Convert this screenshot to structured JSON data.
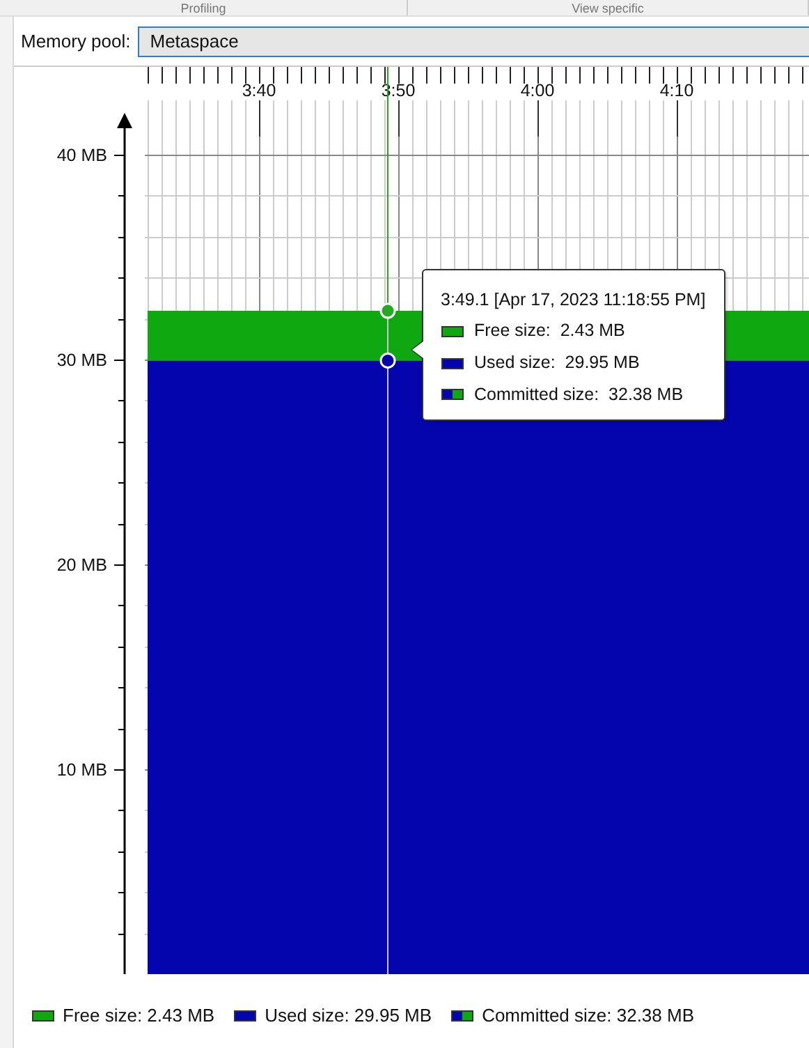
{
  "section_headers": [
    "Profiling",
    "View specific"
  ],
  "memory_pool": {
    "label": "Memory pool:",
    "value": "Metaspace"
  },
  "chart": {
    "chart_data": {
      "type": "area",
      "stacked": true,
      "grid": true,
      "ylim": [
        0,
        41.7
      ],
      "categories": [
        null,
        null,
        null,
        null,
        null,
        null,
        null,
        null,
        "3:40",
        null,
        null,
        null,
        null,
        null,
        null,
        null,
        null,
        null,
        "3:50",
        null,
        null,
        null,
        null,
        null,
        null,
        null,
        null,
        null,
        "4:00",
        null,
        null,
        null,
        null,
        null,
        null,
        null,
        null,
        null,
        "4:10",
        null,
        null,
        null,
        null,
        null,
        null,
        null,
        null,
        null,
        null
      ],
      "series": [
        {
          "color": "#0505ad",
          "values": [
            29.95,
            29.95,
            29.95,
            29.95,
            29.95,
            29.95,
            29.95,
            29.95,
            29.95,
            29.95,
            29.95,
            29.95,
            29.95,
            29.95,
            29.95,
            29.95,
            29.95,
            null,
            29.95,
            29.95,
            null,
            null,
            null,
            null,
            null,
            null,
            null,
            null,
            null,
            null,
            null,
            null,
            null,
            null,
            null,
            null,
            null,
            null,
            null,
            null,
            null,
            null,
            29.95,
            29.95,
            29.95,
            29.95,
            29.95,
            29.95,
            29.95
          ]
        },
        {
          "color": "#10a810",
          "values": [
            2.43,
            2.43,
            2.43,
            2.43,
            2.43,
            2.43,
            2.43,
            2.43,
            2.43,
            2.43,
            2.43,
            2.43,
            2.43,
            2.43,
            2.43,
            2.43,
            2.43,
            null,
            2.43,
            2.43,
            null,
            null,
            null,
            null,
            null,
            null,
            null,
            null,
            null,
            null,
            null,
            null,
            null,
            null,
            null,
            null,
            null,
            null,
            null,
            null,
            null,
            null,
            2.43,
            2.43,
            2.43,
            2.43,
            2.43,
            2.43,
            2.43
          ]
        }
      ],
      "yticks": [
        {
          "value": 10,
          "label": "10 MB"
        },
        {
          "value": 20,
          "label": "20 MB"
        },
        {
          "value": 30,
          "label": "30 MB"
        },
        {
          "value": 40,
          "label": "40 MB"
        }
      ]
    },
    "tooltip": {
      "title": "3:49.1 [Apr 17, 2023 11:18:55 PM]",
      "rows": [
        {
          "kind": "free",
          "label": "Free size:",
          "value": "2.43 MB"
        },
        {
          "kind": "used",
          "label": "Used size:",
          "value": "29.95 MB"
        },
        {
          "kind": "committed",
          "label": "Committed size:",
          "value": "32.38 MB"
        }
      ]
    }
  },
  "legend": [
    {
      "kind": "free",
      "text": "Free size: 2.43 MB"
    },
    {
      "kind": "used",
      "text": "Used size: 29.95 MB"
    },
    {
      "kind": "committed",
      "text": "Committed size: 32.38 MB"
    }
  ]
}
